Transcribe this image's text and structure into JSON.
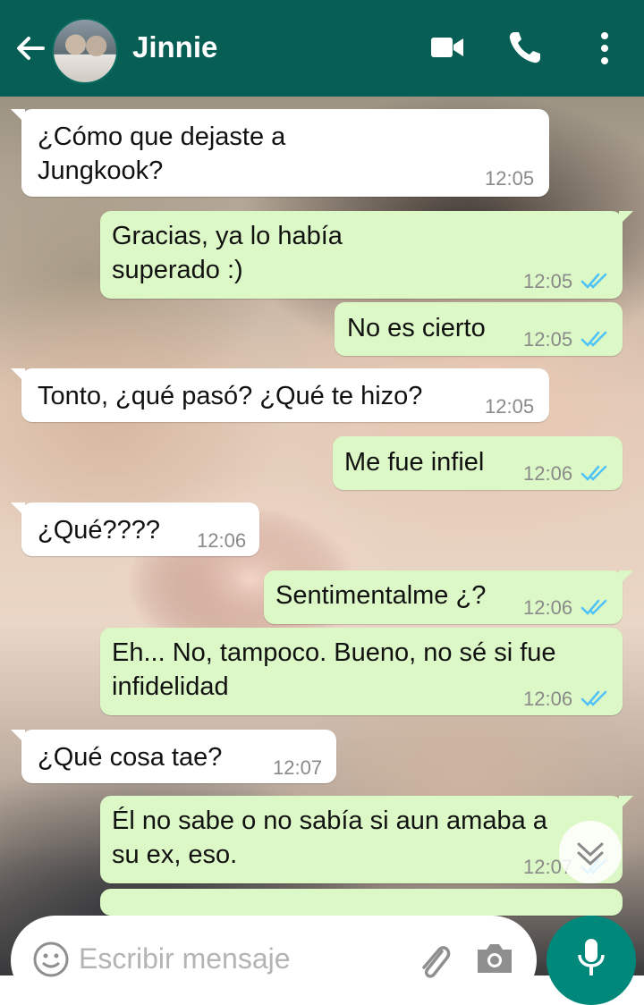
{
  "header": {
    "contact_name": "Jinnie",
    "background_color": "#075e54",
    "back_icon": "arrow-left-icon",
    "video_icon": "video-camera-icon",
    "call_icon": "phone-icon",
    "menu_icon": "more-vertical-icon"
  },
  "messages": [
    {
      "direction": "in",
      "text": "¿Cómo que dejaste a\nJungkook?",
      "time": "12:05"
    },
    {
      "direction": "out",
      "text": "Gracias, ya lo había\nsuperado :)",
      "time": "12:05",
      "status": "read"
    },
    {
      "direction": "out",
      "text": "No es cierto",
      "time": "12:05",
      "status": "read"
    },
    {
      "direction": "in",
      "text": "Tonto, ¿qué pasó? ¿Qué te hizo?",
      "time": "12:05"
    },
    {
      "direction": "out",
      "text": "Me fue infiel",
      "time": "12:06",
      "status": "read"
    },
    {
      "direction": "in",
      "text": "¿Qué????",
      "time": "12:06"
    },
    {
      "direction": "out",
      "text": "Sentimentalme ¿?",
      "time": "12:06",
      "status": "read"
    },
    {
      "direction": "out",
      "text": "Eh... No, tampoco. Bueno, no sé si fue\ninfidelidad",
      "time": "12:06",
      "status": "read"
    },
    {
      "direction": "in",
      "text": "¿Qué cosa tae?",
      "time": "12:07"
    },
    {
      "direction": "out",
      "text": "Él no sabe o no sabía si aun amaba a\nsu ex, eso.",
      "time": "12:07",
      "status": "read"
    }
  ],
  "composer": {
    "placeholder": "Escribir mensaje",
    "emoji_icon": "emoji-icon",
    "attach_icon": "paperclip-icon",
    "camera_icon": "camera-icon",
    "mic_icon": "microphone-icon",
    "mic_color": "#00897b"
  },
  "colors": {
    "incoming_bubble": "#ffffff",
    "outgoing_bubble": "#dcf8c6",
    "read_ticks": "#4fc3f7"
  }
}
